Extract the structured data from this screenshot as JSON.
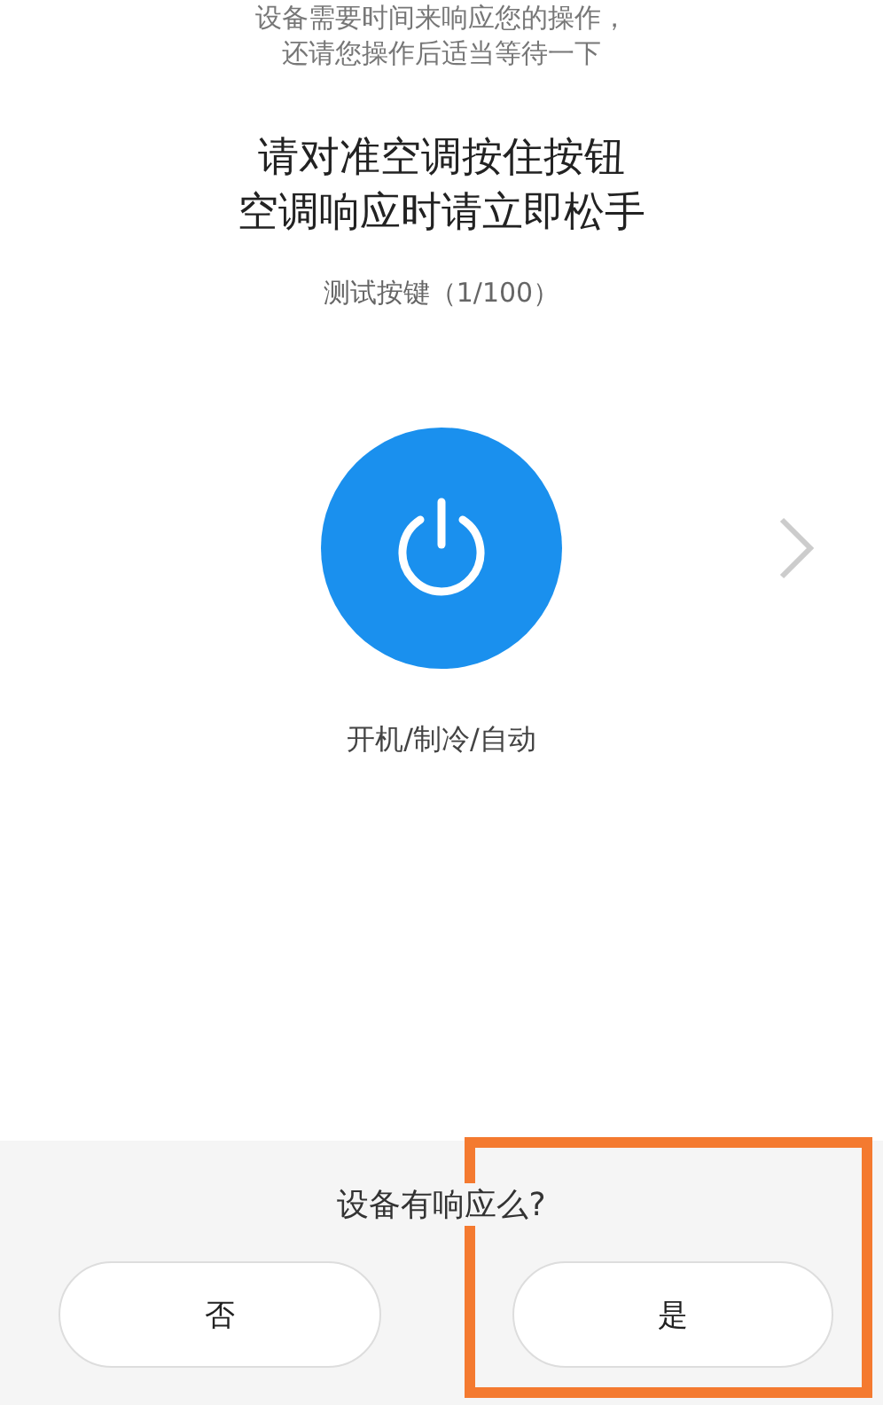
{
  "intro_lines": [
    "设备需要时间来响应您的操作，",
    "还请您操作后适当等待一下"
  ],
  "instruction_lines": [
    "请对准空调按住按钮",
    "空调响应时请立即松手"
  ],
  "test_counter": "测试按键（1/100）",
  "key_label": "开机/制冷/自动",
  "has_next": true,
  "prompt": {
    "question": "设备有响应么?",
    "buttons": [
      {
        "label": "否",
        "highlighted": false
      },
      {
        "label": "是",
        "highlighted": true
      }
    ]
  }
}
